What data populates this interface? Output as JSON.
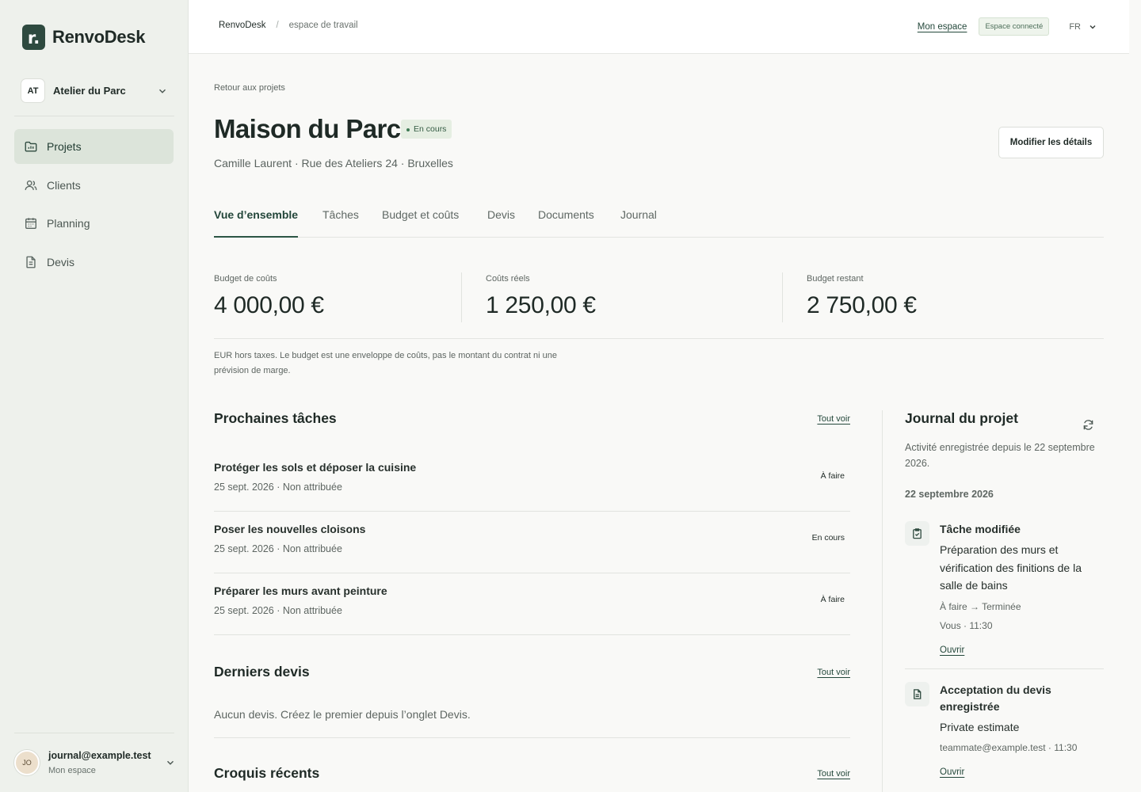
{
  "app": {
    "brand_mark": "r.",
    "brand_name": "RenvoDesk"
  },
  "sidebar": {
    "workspace": {
      "initials": "AT",
      "name": "Atelier du Parc"
    },
    "nav": [
      {
        "label": "Projets",
        "icon": "folder-chart-icon",
        "active": true
      },
      {
        "label": "Clients",
        "icon": "users-icon",
        "active": false
      },
      {
        "label": "Planning",
        "icon": "calendar-icon",
        "active": false
      },
      {
        "label": "Devis",
        "icon": "document-icon",
        "active": false
      }
    ],
    "user": {
      "initials": "JO",
      "email": "journal@example.test",
      "subtitle": "Mon espace"
    }
  },
  "topbar": {
    "breadcrumb_root": "RenvoDesk",
    "breadcrumb_sep": "/",
    "breadcrumb_current": "espace de travail",
    "my_space_link": "Mon espace",
    "connected_badge": "Espace connecté",
    "language": "FR"
  },
  "project": {
    "back_link": "Retour aux projets",
    "title": "Maison du Parc",
    "status": "En cours",
    "subtitle": "Camille Laurent · Rue des Ateliers 24 · Bruxelles",
    "edit_button": "Modifier les détails"
  },
  "tabs": [
    {
      "label": "Vue d’ensemble",
      "active": true
    },
    {
      "label": "Tâches",
      "active": false
    },
    {
      "label": "Budget et coûts",
      "active": false
    },
    {
      "label": "Devis",
      "active": false
    },
    {
      "label": "Documents",
      "active": false
    },
    {
      "label": "Journal",
      "active": false
    }
  ],
  "metrics": [
    {
      "label": "Budget de coûts",
      "value": "4 000,00 €"
    },
    {
      "label": "Coûts réels",
      "value": "1 250,00 €"
    },
    {
      "label": "Budget restant",
      "value": "2 750,00 €"
    }
  ],
  "budget_note": "EUR hors taxes. Le budget est une enveloppe de coûts, pas le montant du contrat ni une prévision de marge.",
  "next_tasks": {
    "title": "Prochaines tâches",
    "see_all": "Tout voir",
    "items": [
      {
        "title": "Protéger les sols et déposer la cuisine",
        "meta": "25 sept. 2026 · Non attribuée",
        "status": "À faire"
      },
      {
        "title": "Poser les nouvelles cloisons",
        "meta": "25 sept. 2026 · Non attribuée",
        "status": "En cours"
      },
      {
        "title": "Préparer les murs avant peinture",
        "meta": "25 sept. 2026 · Non attribuée",
        "status": "À faire"
      }
    ]
  },
  "latest_quotes": {
    "title": "Derniers devis",
    "see_all": "Tout voir",
    "empty": "Aucun devis. Créez le premier depuis l’onglet Devis."
  },
  "recent_sketches": {
    "title": "Croquis récents",
    "see_all": "Tout voir"
  },
  "journal": {
    "title": "Journal du projet",
    "subtitle": "Activité enregistrée depuis le 22 septembre 2026.",
    "date": "22 septembre 2026",
    "entries": [
      {
        "icon": "clipboard-check-icon",
        "title": "Tâche modifiée",
        "body": "Préparation des murs et vérification des finitions de la salle de bains",
        "change": "À faire → Terminée",
        "meta": "Vous · 11:30",
        "link": "Ouvrir"
      },
      {
        "icon": "document-icon",
        "title": "Acceptation du devis enregistrée",
        "body": "Private estimate",
        "meta": "teammate@example.test · 11:30",
        "link": "Ouvrir"
      }
    ]
  }
}
